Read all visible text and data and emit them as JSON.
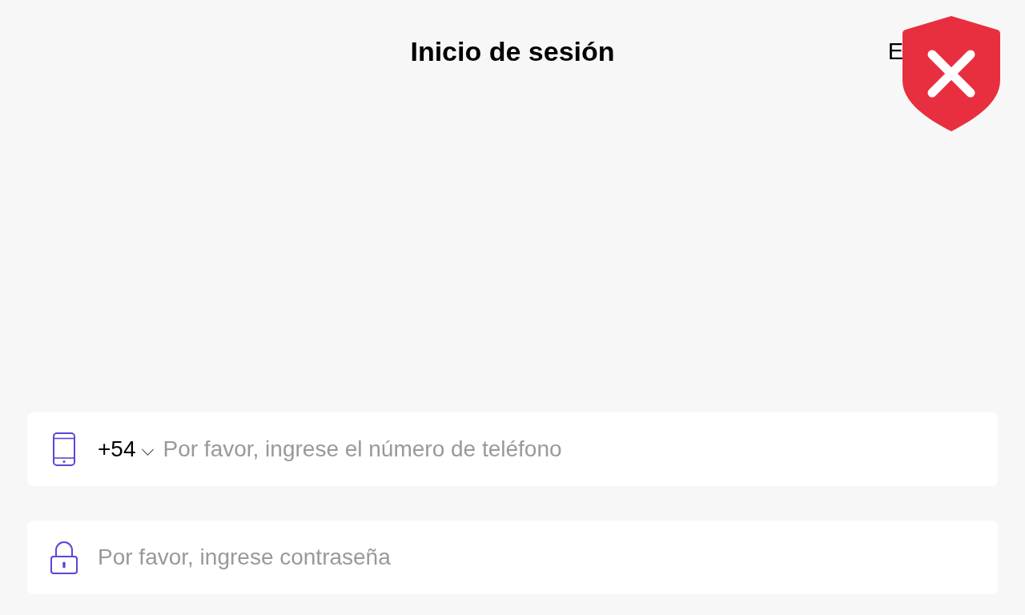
{
  "header": {
    "title": "Inicio de sesión",
    "corner_text": "E"
  },
  "fields": [
    {
      "kind": "phone",
      "country_code": "+54",
      "placeholder": "Por favor, ingrese el número de teléfono"
    },
    {
      "kind": "password",
      "placeholder": "Por favor, ingrese contraseña"
    }
  ]
}
